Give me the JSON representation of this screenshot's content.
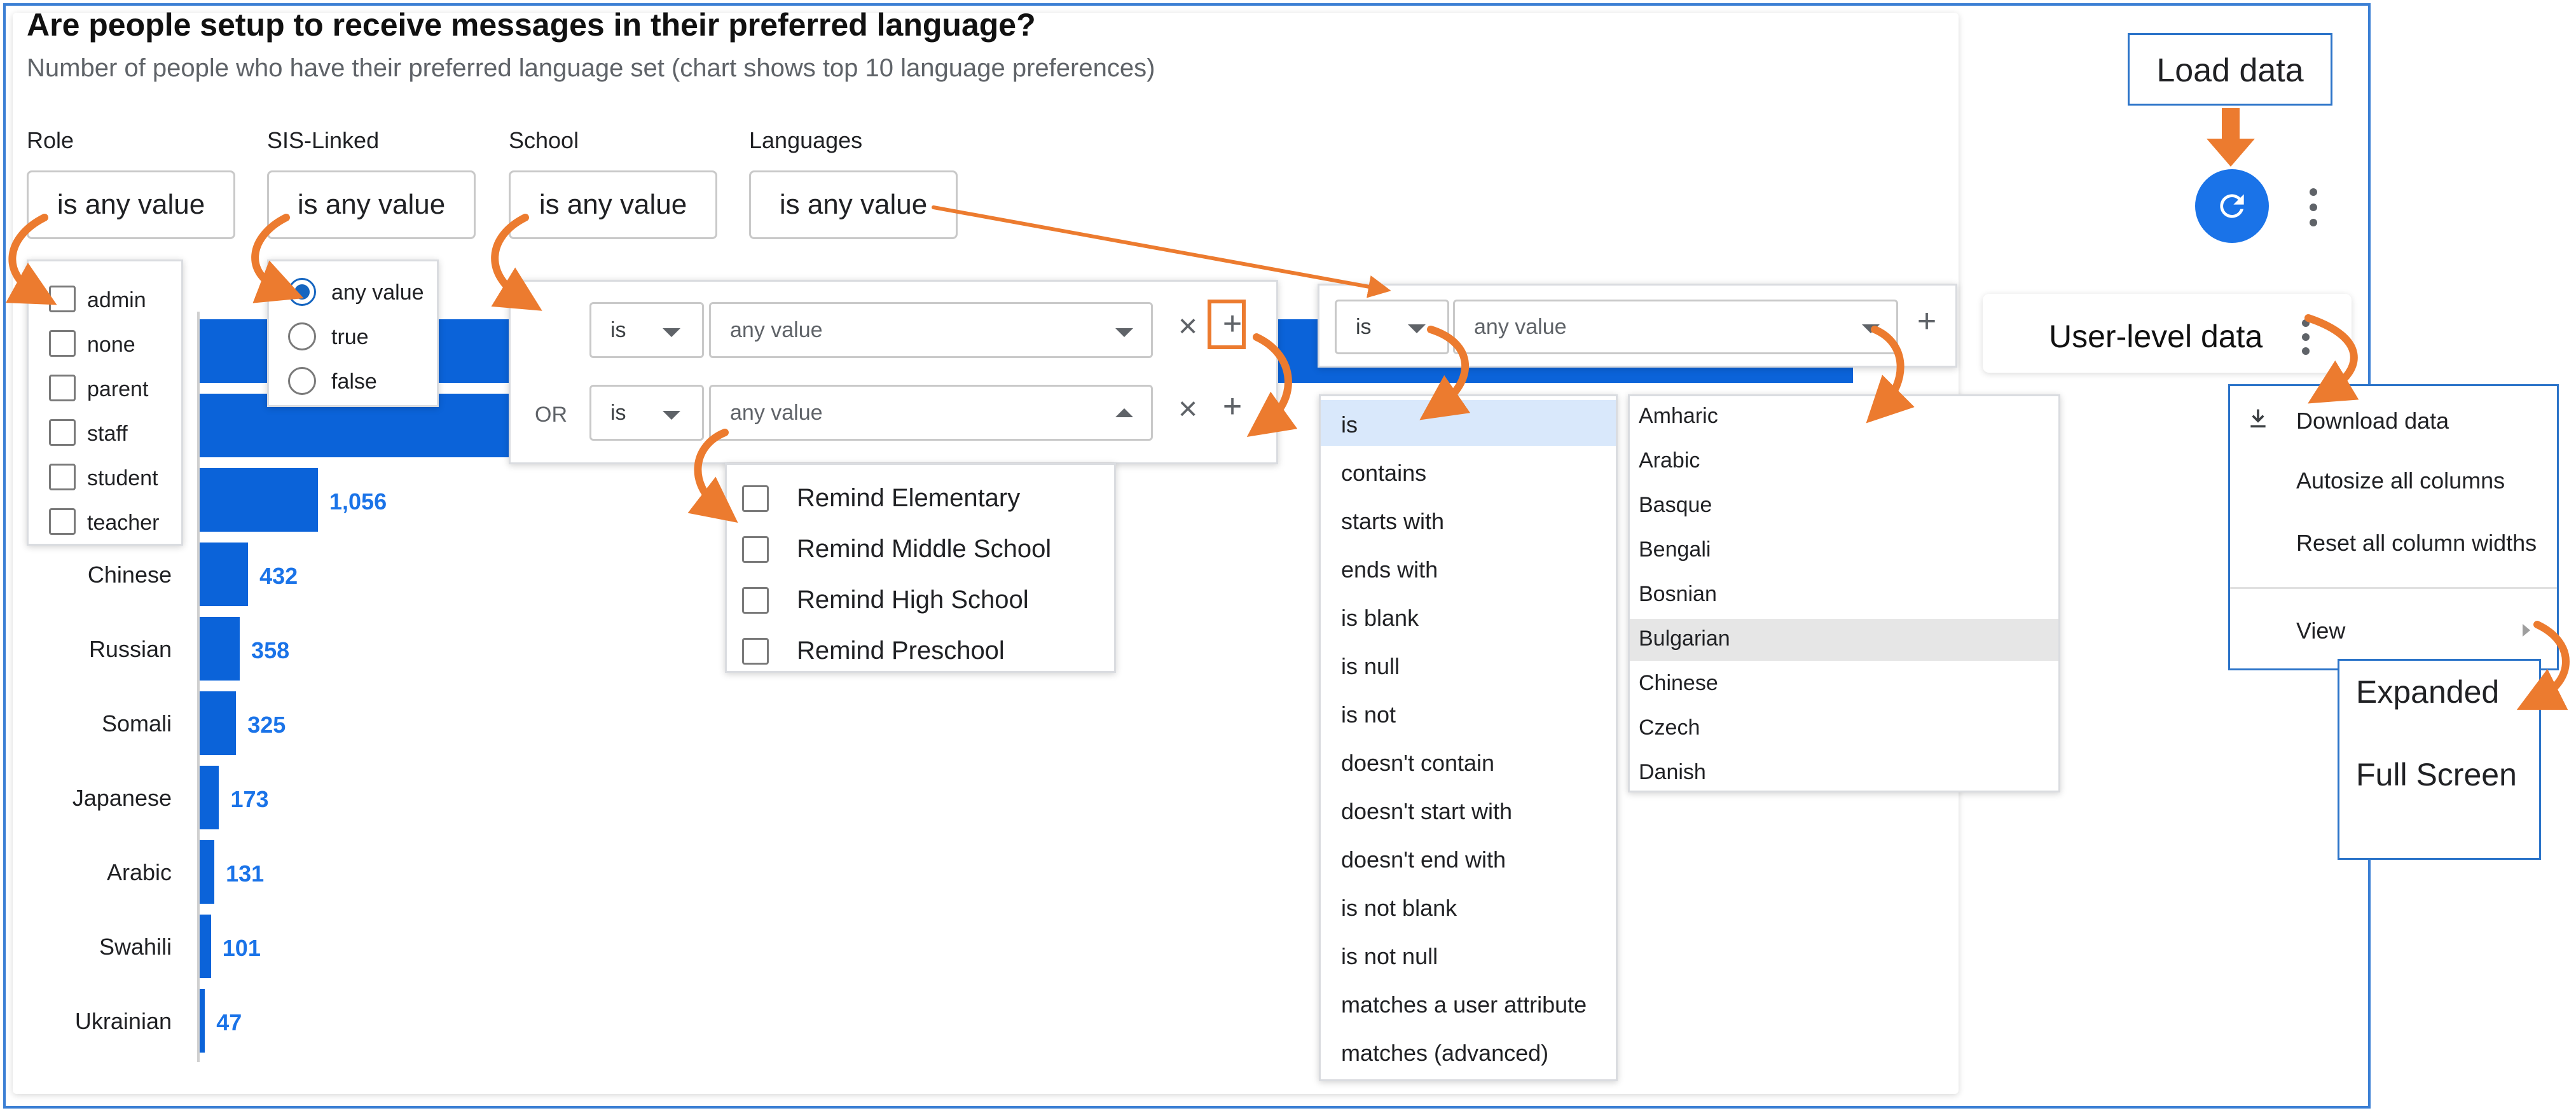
{
  "title": "Are people setup to receive messages in their preferred language?",
  "subtitle": "Number of people who have their preferred language set (chart shows top 10 language preferences)",
  "filters": [
    {
      "label": "Role",
      "value": "is any value"
    },
    {
      "label": "SIS-Linked",
      "value": "is any value"
    },
    {
      "label": "School",
      "value": "is any value"
    },
    {
      "label": "Languages",
      "value": "is any value"
    }
  ],
  "role_options": [
    "admin",
    "none",
    "parent",
    "staff",
    "student",
    "teacher"
  ],
  "sis_options": [
    "any value",
    "true",
    "false"
  ],
  "school_condition": {
    "operator": "is",
    "value_placeholder": "any value",
    "or_label": "OR"
  },
  "school_options": [
    "Remind Elementary",
    "Remind Middle School",
    "Remind High School",
    "Remind Preschool"
  ],
  "language_condition": {
    "operator": "is",
    "value_placeholder": "any value"
  },
  "operator_options": [
    "is",
    "contains",
    "starts with",
    "ends with",
    "is blank",
    "is null",
    "is not",
    "doesn't contain",
    "doesn't start with",
    "doesn't end with",
    "is not blank",
    "is not null",
    "matches a user attribute",
    "matches (advanced)"
  ],
  "language_options": [
    "Amharic",
    "Arabic",
    "Basque",
    "Bengali",
    "Bosnian",
    "Bulgarian",
    "Chinese",
    "Czech",
    "Danish"
  ],
  "user_level": {
    "title": "User-level data"
  },
  "more_menu": {
    "items": [
      "Download data",
      "Autosize all columns",
      "Reset all column widths",
      "View"
    ]
  },
  "view_submenu": [
    "Expanded",
    "Full Screen"
  ],
  "callout_load": "Load data",
  "colors": {
    "bar": "#0b63d9",
    "accent": "#1a73e8",
    "arrow": "#ec7b2f",
    "callout": "#2c74c9"
  },
  "chart_data": {
    "type": "bar",
    "orientation": "horizontal",
    "categories": [
      "",
      "",
      "",
      "Chinese",
      "Russian",
      "Somali",
      "Japanese",
      "Arabic",
      "Swahili",
      "Ukrainian"
    ],
    "values": [
      null,
      null,
      1056,
      432,
      358,
      325,
      173,
      131,
      101,
      47
    ],
    "value_labels": [
      "",
      "",
      "1,056",
      "432",
      "358",
      "325",
      "173",
      "131",
      "101",
      "47"
    ]
  }
}
